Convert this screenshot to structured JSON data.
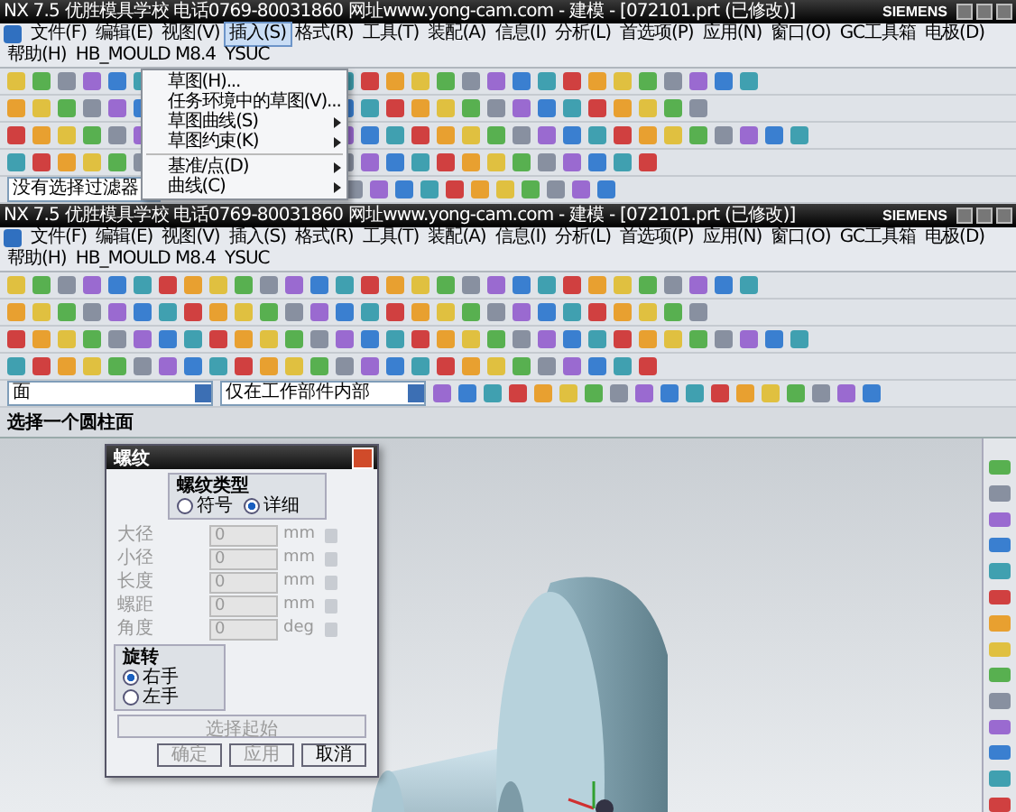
{
  "top_window": {
    "title": "NX 7.5 优胜模具学校 电话0769-80031860 网址www.yong-cam.com - 建模 - [072101.prt (已修改)]",
    "brand": "SIEMENS",
    "menu": [
      {
        "label": "文件(F)",
        "selected": false
      },
      {
        "label": "编辑(E)",
        "selected": false
      },
      {
        "label": "视图(V)",
        "selected": false
      },
      {
        "label": "插入(S)",
        "selected": true
      },
      {
        "label": "格式(R)",
        "selected": false
      },
      {
        "label": "工具(T)",
        "selected": false
      },
      {
        "label": "装配(A)",
        "selected": false
      },
      {
        "label": "信息(I)",
        "selected": false
      },
      {
        "label": "分析(L)",
        "selected": false
      },
      {
        "label": "首选项(P)",
        "selected": false
      },
      {
        "label": "应用(N)",
        "selected": false
      },
      {
        "label": "窗口(O)",
        "selected": false
      },
      {
        "label": "GC工具箱",
        "selected": false
      },
      {
        "label": "电极(D)",
        "selected": false
      },
      {
        "label": "帮助(H)",
        "selected": false
      },
      {
        "label": "HB_MOULD M8.4",
        "selected": false
      },
      {
        "label": "YSUC",
        "selected": false
      }
    ],
    "filters": [
      "没有选择过滤器"
    ],
    "dropdown": [
      {
        "label": "草图(H)...",
        "has_submenu": false,
        "separator_before": false
      },
      {
        "label": "任务环境中的草图(V)...",
        "has_submenu": false,
        "separator_before": false
      },
      {
        "label": "草图曲线(S)",
        "has_submenu": true,
        "separator_before": false
      },
      {
        "label": "草图约束(K)",
        "has_submenu": true,
        "separator_before": false
      },
      {
        "label": "基准/点(D)",
        "has_submenu": true,
        "separator_before": true
      },
      {
        "label": "曲线(C)",
        "has_submenu": true,
        "separator_before": false
      }
    ]
  },
  "main_window": {
    "title": "NX 7.5 优胜模具学校 电话0769-80031860 网址www.yong-cam.com - 建模 - [072101.prt (已修改)]",
    "brand": "SIEMENS",
    "menu": [
      {
        "label": "文件(F)",
        "selected": false
      },
      {
        "label": "编辑(E)",
        "selected": false
      },
      {
        "label": "视图(V)",
        "selected": false
      },
      {
        "label": "插入(S)",
        "selected": false
      },
      {
        "label": "格式(R)",
        "selected": false
      },
      {
        "label": "工具(T)",
        "selected": false
      },
      {
        "label": "装配(A)",
        "selected": false
      },
      {
        "label": "信息(I)",
        "selected": false
      },
      {
        "label": "分析(L)",
        "selected": false
      },
      {
        "label": "首选项(P)",
        "selected": false
      },
      {
        "label": "应用(N)",
        "selected": false
      },
      {
        "label": "窗口(O)",
        "selected": false
      },
      {
        "label": "GC工具箱",
        "selected": false
      },
      {
        "label": "电极(D)",
        "selected": false
      },
      {
        "label": "帮助(H)",
        "selected": false
      },
      {
        "label": "HB_MOULD M8.4",
        "selected": false
      },
      {
        "label": "YSUC",
        "selected": false
      }
    ],
    "filters": [
      "面",
      "仅在工作部件内部"
    ],
    "status": "选择一个圆柱面"
  },
  "dialog": {
    "title": "螺纹",
    "type_group": "螺纹类型",
    "types": [
      {
        "label": "符号",
        "selected": false
      },
      {
        "label": "详细",
        "selected": true
      }
    ],
    "fields": [
      {
        "label": "大径",
        "value": "0",
        "unit": "mm",
        "disabled": true
      },
      {
        "label": "小径",
        "value": "0",
        "unit": "mm",
        "disabled": true
      },
      {
        "label": "长度",
        "value": "0",
        "unit": "mm",
        "disabled": true
      },
      {
        "label": "螺距",
        "value": "0",
        "unit": "mm",
        "disabled": true
      },
      {
        "label": "角度",
        "value": "0",
        "unit": "deg",
        "disabled": true
      }
    ],
    "rotation_group": "旋转",
    "rotations": [
      {
        "label": "右手",
        "selected": true
      },
      {
        "label": "左手",
        "selected": false
      }
    ],
    "select_start": {
      "label": "选择起始",
      "disabled": true
    },
    "buttons": [
      {
        "label": "确定",
        "disabled": true
      },
      {
        "label": "应用",
        "disabled": true
      },
      {
        "label": "取消",
        "disabled": false
      }
    ]
  }
}
